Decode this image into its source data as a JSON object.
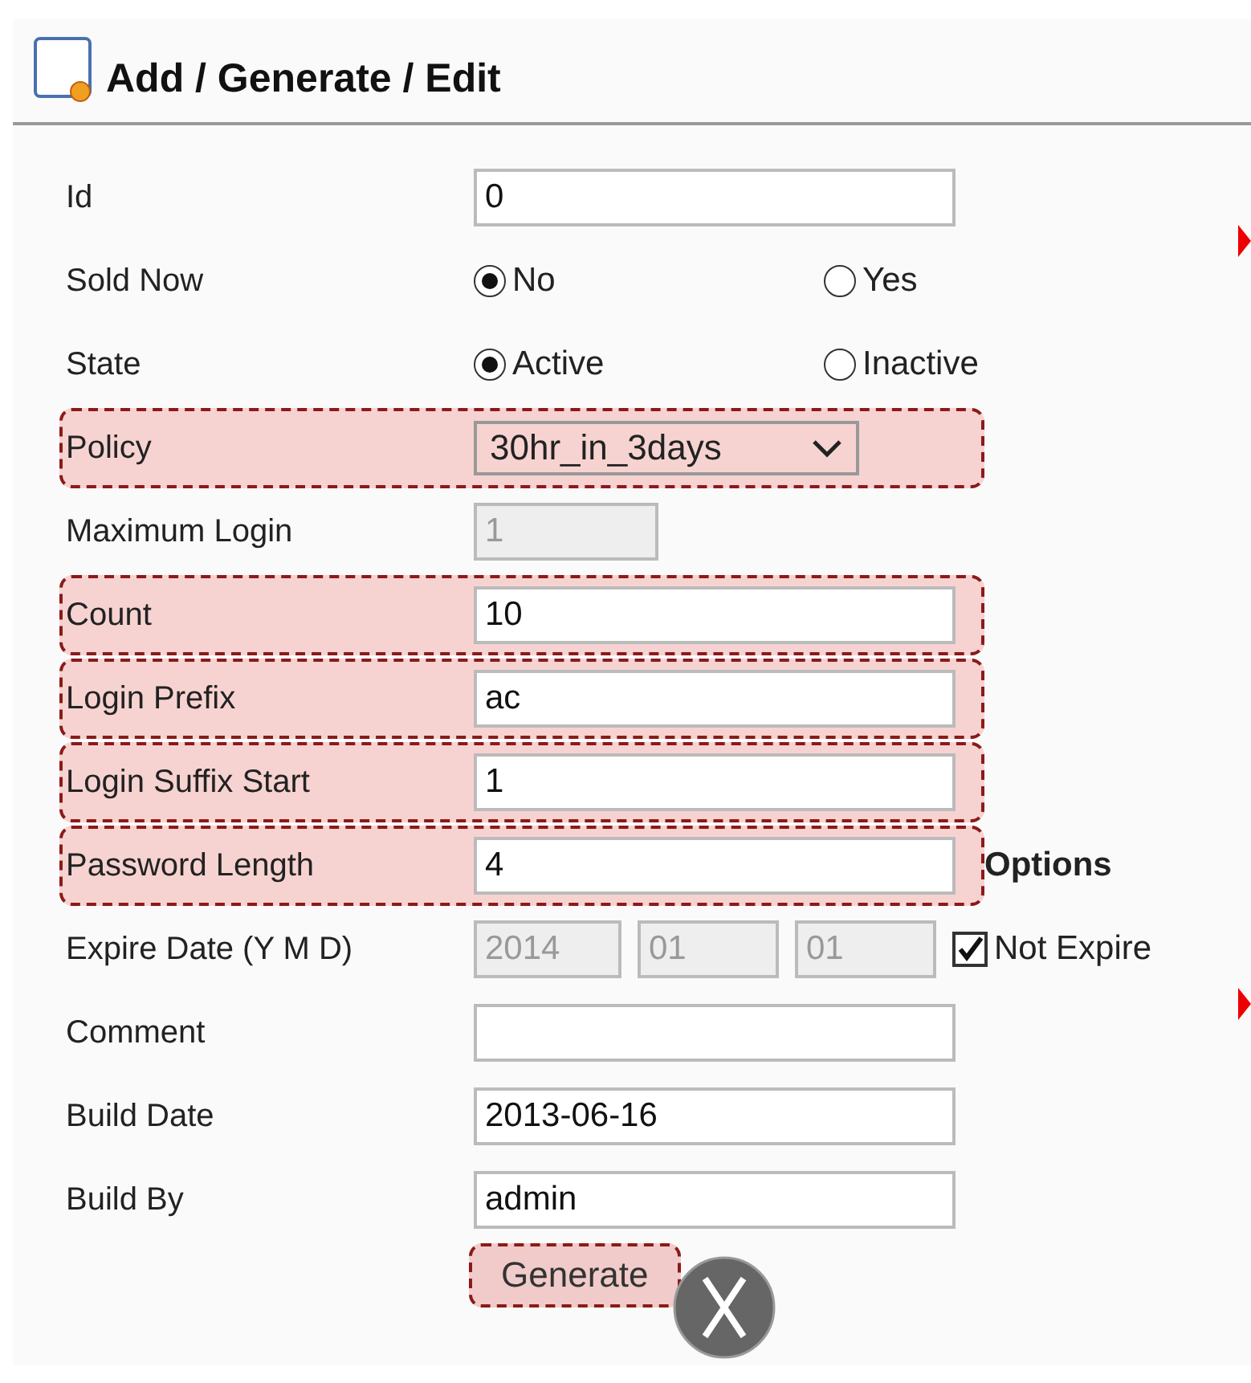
{
  "header": {
    "title": "Add / Generate / Edit"
  },
  "fields": [
    {
      "kind": "text",
      "label": "Id",
      "value": "0",
      "disabled": false,
      "highlighted": false
    },
    {
      "kind": "radio",
      "label": "Sold Now",
      "options": [
        {
          "label": "No",
          "selected": true
        },
        {
          "label": "Yes",
          "selected": false
        }
      ],
      "highlighted": false
    },
    {
      "kind": "radio",
      "label": "State",
      "options": [
        {
          "label": "Active",
          "selected": true
        },
        {
          "label": "Inactive",
          "selected": false
        }
      ],
      "highlighted": false
    },
    {
      "kind": "select",
      "label": "Policy",
      "value": "30hr_in_3days",
      "highlighted": true
    },
    {
      "kind": "short",
      "label": "Maximum Login",
      "value": "1",
      "disabled": true,
      "highlighted": false
    },
    {
      "kind": "text",
      "label": "Count",
      "value": "10",
      "disabled": false,
      "highlighted": true
    },
    {
      "kind": "text",
      "label": "Login Prefix",
      "value": "ac",
      "disabled": false,
      "highlighted": true
    },
    {
      "kind": "text",
      "label": "Login Suffix Start",
      "value": "1",
      "disabled": false,
      "highlighted": true
    },
    {
      "kind": "text",
      "label": "Password Length",
      "value": "4",
      "disabled": false,
      "highlighted": true,
      "note": "Options"
    },
    {
      "kind": "date",
      "label": "Expire Date (Y M D)",
      "values": [
        "2014",
        "01",
        "01"
      ],
      "disabled": true,
      "checkbox": {
        "label": "Not Expire",
        "checked": true
      },
      "highlighted": false
    },
    {
      "kind": "text",
      "label": "Comment",
      "disabled": false,
      "highlighted": false
    },
    {
      "kind": "text",
      "label": "Build Date",
      "value": "2013-06-16",
      "disabled": false,
      "highlighted": false
    },
    {
      "kind": "text",
      "label": "Build By",
      "value": "admin",
      "disabled": false,
      "highlighted": false
    }
  ],
  "button": {
    "label": "Generate",
    "highlighted": true
  }
}
